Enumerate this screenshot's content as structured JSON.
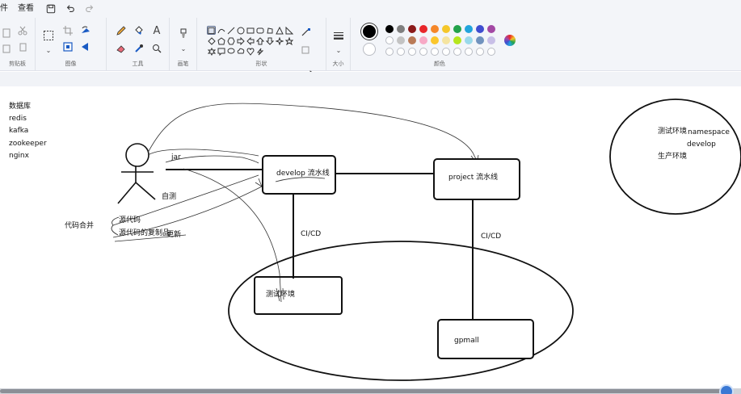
{
  "menu": {
    "file_partial": "件",
    "view": "查看"
  },
  "ribbon": {
    "clipboard_label": "剪贴板",
    "image_label": "图像",
    "tools_label": "工具",
    "brush_label": "画笔",
    "shapes_label": "形状",
    "size_label": "大小",
    "colors_label": "颜色",
    "text_tool_glyph": "A"
  },
  "palette": {
    "primary": "#000000",
    "secondary": "#ffffff",
    "row1": [
      "#000000",
      "#7f7f7f",
      "#8b1a1a",
      "#e8262b",
      "#f5872a",
      "#f5c72a",
      "#22a24b",
      "#21a4dc",
      "#3f4dd0",
      "#a348a4"
    ],
    "row2": [
      "#ffffff",
      "#c3c3c3",
      "#b97a57",
      "#f7a9c6",
      "#fbc62c",
      "#f5e4a0",
      "#b5e61d",
      "#99d9ea",
      "#7092be",
      "#c8bfe7"
    ]
  },
  "canvas": {
    "left_list": [
      "数据库",
      "redis",
      "kafka",
      "zookeeper",
      "nginx"
    ],
    "jar": "jar",
    "self_test": "自测",
    "code_merge": "代码合并",
    "source_code": "源代码",
    "source_copy": "源代码的复制品",
    "update": "更新",
    "develop_pipeline": "develop 流水线",
    "project_pipeline": "project 流水线",
    "cicd_left": "CI/CD",
    "cicd_right": "CI/CD",
    "test_env": "测试环境",
    "gpmall": "gpmall",
    "legend_test_env": "测试环境",
    "legend_namespace": "namespace",
    "legend_develop": "develop",
    "legend_prod_env": "生产环境"
  }
}
